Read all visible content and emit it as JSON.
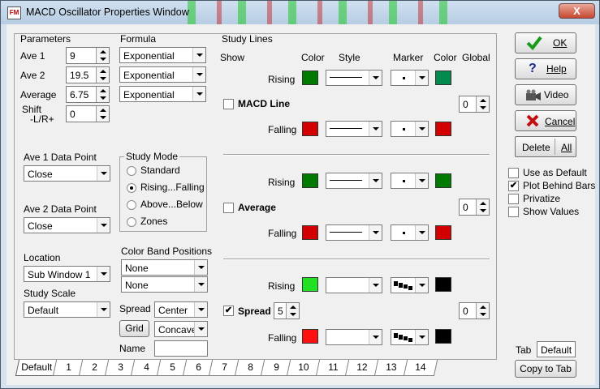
{
  "window": {
    "title": "MACD Oscillator Properties Window",
    "icon": "FM",
    "close_label": "X"
  },
  "parameters": {
    "heading": "Parameters",
    "ave1_label": "Ave 1",
    "ave1": "9",
    "ave2_label": "Ave 2",
    "ave2": "19.5",
    "average_label": "Average",
    "average": "6.75",
    "shift_label1": "Shift",
    "shift_label2": "-L/R+",
    "shift": "0"
  },
  "formula": {
    "heading": "Formula",
    "values": [
      "Exponential",
      "Exponential",
      "Exponential"
    ]
  },
  "data_points": {
    "ave1_label": "Ave 1 Data Point",
    "ave1": "Close",
    "ave2_label": "Ave 2 Data Point",
    "ave2": "Close"
  },
  "study_mode": {
    "heading": "Study Mode",
    "options": [
      "Standard",
      "Rising...Falling",
      "Above...Below",
      "Zones"
    ],
    "selected": "Rising...Falling"
  },
  "location": {
    "label": "Location",
    "value": "Sub Window  1"
  },
  "study_scale": {
    "label": "Study Scale",
    "value": "Default"
  },
  "color_band": {
    "label": "Color Band Positions",
    "values": [
      "None",
      "None"
    ]
  },
  "spread_opts": {
    "label": "Spread",
    "value": "Center",
    "grid_label": "Grid",
    "grid_value": "Concave",
    "name_label": "Name",
    "name_value": ""
  },
  "study_lines": {
    "heading": "Study Lines",
    "headers": {
      "show": "Show",
      "color": "Color",
      "style": "Style",
      "marker": "Marker",
      "color2": "Color",
      "global": "Global"
    },
    "rising_label": "Rising",
    "falling_label": "Falling",
    "lines": [
      {
        "name": "MACD Line",
        "checked": false,
        "global": "0",
        "rising_color": "#007a00",
        "rising_marker_color": "#008a4e",
        "falling_color": "#d20000",
        "falling_marker_color": "#d20000"
      },
      {
        "name": "Average",
        "checked": false,
        "global": "0",
        "rising_color": "#007a00",
        "rising_marker_color": "#007a00",
        "falling_color": "#d20000",
        "falling_marker_color": "#d20000"
      },
      {
        "name": "Spread",
        "checked": true,
        "spread_value": "5",
        "global": "0",
        "rising_color": "#22e022",
        "rising_marker_color": "#000000",
        "falling_color": "#ff1010",
        "falling_marker_color": "#000000"
      }
    ]
  },
  "buttons": {
    "ok": "OK",
    "help": "Help",
    "video": "Video",
    "cancel": "Cancel",
    "delete": "Delete",
    "all": "All",
    "copy_to_tab": "Copy to Tab"
  },
  "options": [
    {
      "label": "Use as Default",
      "checked": false
    },
    {
      "label": "Plot Behind Bars",
      "checked": true
    },
    {
      "label": "Privatize",
      "checked": false
    },
    {
      "label": "Show Values",
      "checked": false
    }
  ],
  "tab_field": {
    "label": "Tab",
    "value": "Default"
  },
  "tabs": [
    "Default",
    "1",
    "2",
    "3",
    "4",
    "5",
    "6",
    "7",
    "8",
    "9",
    "10",
    "11",
    "12",
    "13",
    "14"
  ],
  "active_tab": "Default"
}
